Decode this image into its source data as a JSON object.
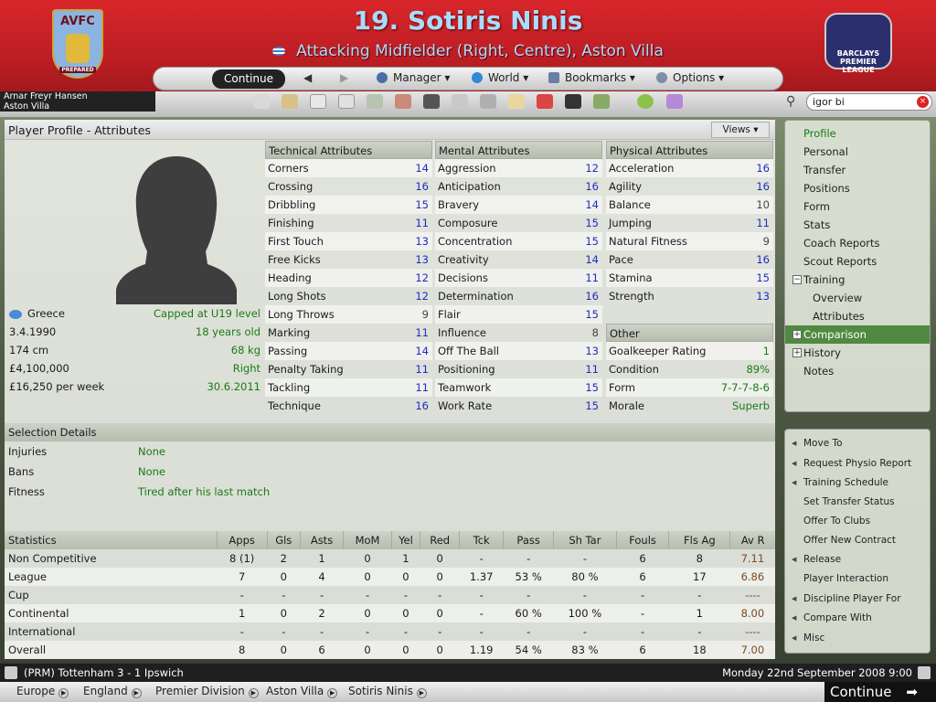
{
  "header": {
    "club_crest": {
      "title": "AVFC",
      "motto": "PREPARED"
    },
    "player_title": "19. Sotiris Ninis",
    "player_subtitle": "Attacking Midfielder (Right, Centre), Aston Villa",
    "league_logo": "BARCLAYS PREMIER LEAGUE"
  },
  "menubar": {
    "continue_label": "Continue",
    "items": [
      "Manager",
      "World",
      "Bookmarks",
      "Options"
    ]
  },
  "manager": {
    "name": "Arnar Freyr Hansen",
    "club": "Aston Villa"
  },
  "search": {
    "value": "igor bi"
  },
  "panel": {
    "title": "Player Profile - Attributes",
    "views_label": "Views"
  },
  "bio": [
    {
      "left": "Greece",
      "right": "Capped at U19 level"
    },
    {
      "left": "3.4.1990",
      "right": "18 years old"
    },
    {
      "left": "174 cm",
      "right": "68 kg"
    },
    {
      "left": "£4,100,000",
      "right": "Right"
    },
    {
      "left": "£16,250 per week",
      "right": "30.6.2011"
    }
  ],
  "technical": {
    "title": "Technical Attributes",
    "rows": [
      {
        "name": "Corners",
        "value": "14"
      },
      {
        "name": "Crossing",
        "value": "16"
      },
      {
        "name": "Dribbling",
        "value": "15"
      },
      {
        "name": "Finishing",
        "value": "11"
      },
      {
        "name": "First Touch",
        "value": "13"
      },
      {
        "name": "Free Kicks",
        "value": "13"
      },
      {
        "name": "Heading",
        "value": "12"
      },
      {
        "name": "Long Shots",
        "value": "12"
      },
      {
        "name": "Long Throws",
        "value": "9"
      },
      {
        "name": "Marking",
        "value": "11"
      },
      {
        "name": "Passing",
        "value": "14"
      },
      {
        "name": "Penalty Taking",
        "value": "11"
      },
      {
        "name": "Tackling",
        "value": "11"
      },
      {
        "name": "Technique",
        "value": "16"
      }
    ]
  },
  "mental": {
    "title": "Mental Attributes",
    "rows": [
      {
        "name": "Aggression",
        "value": "12"
      },
      {
        "name": "Anticipation",
        "value": "16"
      },
      {
        "name": "Bravery",
        "value": "14"
      },
      {
        "name": "Composure",
        "value": "15"
      },
      {
        "name": "Concentration",
        "value": "15"
      },
      {
        "name": "Creativity",
        "value": "14"
      },
      {
        "name": "Decisions",
        "value": "11"
      },
      {
        "name": "Determination",
        "value": "16"
      },
      {
        "name": "Flair",
        "value": "15"
      },
      {
        "name": "Influence",
        "value": "8"
      },
      {
        "name": "Off The Ball",
        "value": "13"
      },
      {
        "name": "Positioning",
        "value": "11"
      },
      {
        "name": "Teamwork",
        "value": "15"
      },
      {
        "name": "Work Rate",
        "value": "15"
      }
    ]
  },
  "physical": {
    "title": "Physical Attributes",
    "rows": [
      {
        "name": "Acceleration",
        "value": "16"
      },
      {
        "name": "Agility",
        "value": "16"
      },
      {
        "name": "Balance",
        "value": "10"
      },
      {
        "name": "Jumping",
        "value": "11"
      },
      {
        "name": "Natural Fitness",
        "value": "9"
      },
      {
        "name": "Pace",
        "value": "16"
      },
      {
        "name": "Stamina",
        "value": "15"
      },
      {
        "name": "Strength",
        "value": "13"
      }
    ]
  },
  "other": {
    "title": "Other",
    "rows": [
      {
        "name": "Goalkeeper Rating",
        "value": "1"
      },
      {
        "name": "Condition",
        "value": "89%"
      },
      {
        "name": "Form",
        "value": "7-7-7-8-6"
      },
      {
        "name": "Morale",
        "value": "Superb"
      }
    ]
  },
  "selection": {
    "title": "Selection Details",
    "rows": [
      {
        "label": "Injuries",
        "value": "None"
      },
      {
        "label": "Bans",
        "value": "None"
      },
      {
        "label": "Fitness",
        "value": "Tired after his last match"
      }
    ]
  },
  "statistics": {
    "headers": [
      "Statistics",
      "Apps",
      "Gls",
      "Asts",
      "MoM",
      "Yel",
      "Red",
      "Tck",
      "Pass",
      "Sh Tar",
      "Fouls",
      "Fls Ag",
      "Av R"
    ],
    "rows": [
      [
        "Non Competitive",
        "8 (1)",
        "2",
        "1",
        "0",
        "1",
        "0",
        "-",
        "-",
        "-",
        "6",
        "8",
        "7.11"
      ],
      [
        "League",
        "7",
        "0",
        "4",
        "0",
        "0",
        "0",
        "1.37",
        "53 %",
        "80 %",
        "6",
        "17",
        "6.86"
      ],
      [
        "Cup",
        "-",
        "-",
        "-",
        "-",
        "-",
        "-",
        "-",
        "-",
        "-",
        "-",
        "-",
        "----"
      ],
      [
        "Continental",
        "1",
        "0",
        "2",
        "0",
        "0",
        "0",
        "-",
        "60 %",
        "100 %",
        "-",
        "1",
        "8.00"
      ],
      [
        "International",
        "-",
        "-",
        "-",
        "-",
        "-",
        "-",
        "-",
        "-",
        "-",
        "-",
        "-",
        "----"
      ],
      [
        "Overall",
        "8",
        "0",
        "6",
        "0",
        "0",
        "0",
        "1.19",
        "54 %",
        "83 %",
        "6",
        "18",
        "7.00"
      ]
    ]
  },
  "sidenav": [
    {
      "label": "Profile"
    },
    {
      "label": "Personal"
    },
    {
      "label": "Transfer"
    },
    {
      "label": "Positions"
    },
    {
      "label": "Form"
    },
    {
      "label": "Stats"
    },
    {
      "label": "Coach Reports"
    },
    {
      "label": "Scout Reports"
    },
    {
      "label": "Training"
    },
    {
      "label": "Overview"
    },
    {
      "label": "Attributes"
    },
    {
      "label": "Comparison"
    },
    {
      "label": "History"
    },
    {
      "label": "Notes"
    }
  ],
  "actions": [
    "Move To",
    "Request Physio Report",
    "Training Schedule",
    "Set Transfer Status",
    "Offer To Clubs",
    "Offer New Contract",
    "Release",
    "Player Interaction",
    "Discipline Player For",
    "Compare With",
    "Misc"
  ],
  "status": {
    "news": "(PRM) Tottenham 3 - 1 Ipswich",
    "date": "Monday 22nd September 2008 9:00"
  },
  "breadcrumbs": [
    "Europe",
    "England",
    "Premier Division",
    "Aston Villa",
    "Sotiris Ninis"
  ],
  "footer": {
    "continue_label": "Continue"
  },
  "colors": {
    "header_red": "#c8222a",
    "value_blue": "#1f2ac4",
    "value_green": "#1a7a15",
    "selected": "#4f8a40"
  }
}
